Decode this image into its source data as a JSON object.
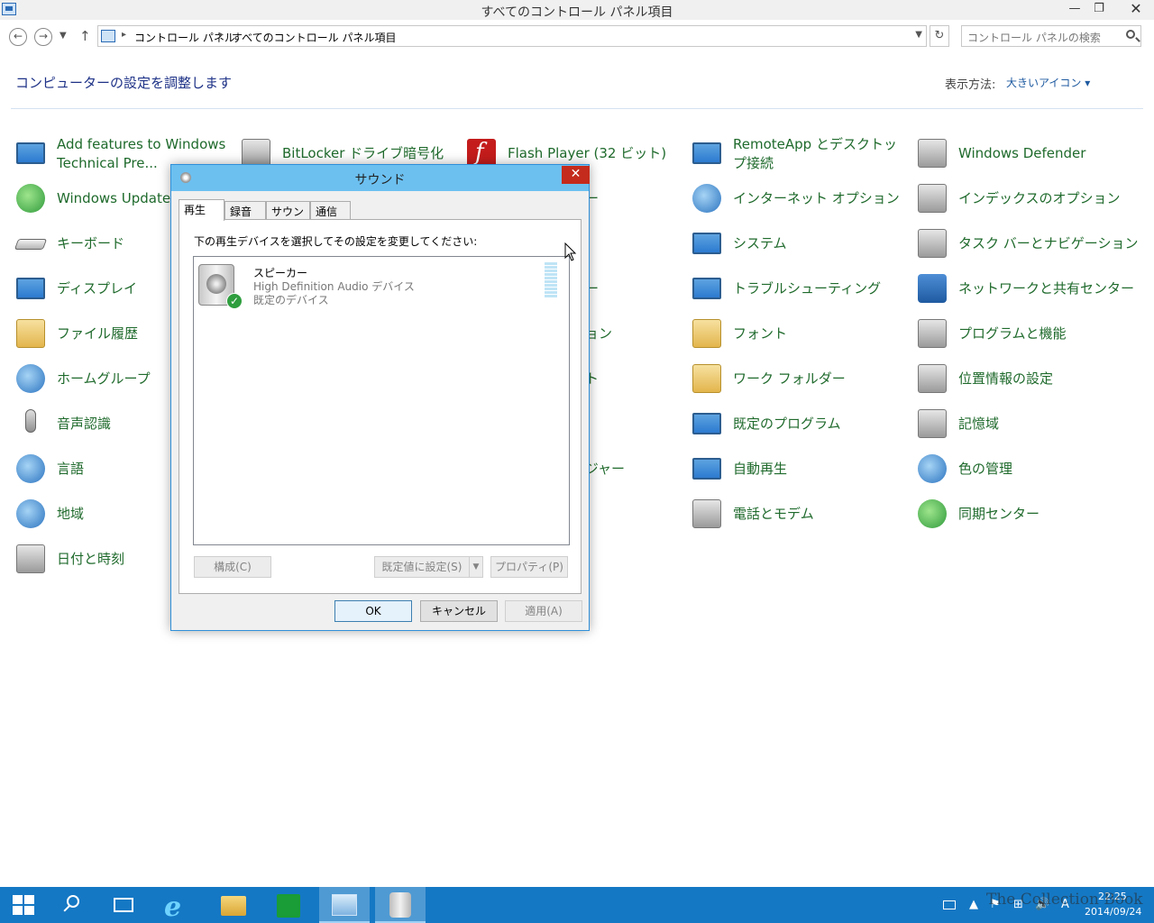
{
  "window": {
    "title": "すべてのコントロール パネル項目",
    "min": "—",
    "max": "❐",
    "close": "✕"
  },
  "address": {
    "crumbs": [
      "コントロール パネル",
      "すべてのコントロール パネル項目"
    ],
    "search_placeholder": "コントロール パネルの検索"
  },
  "header": {
    "title": "コンピューターの設定を調整します",
    "view_by_label": "表示方法:",
    "view_by_value": "大きいアイコン ▾"
  },
  "items": {
    "col1": [
      "Add features to Windows Technical Pre...",
      "Windows Update",
      "キーボード",
      "ディスプレイ",
      "ファイル履歴",
      "ホームグループ",
      "音声認識",
      "言語",
      "地域",
      "日付と時刻"
    ],
    "col2": [
      "BitLocker ドライブ暗号化"
    ],
    "col3": [
      "Flash Player (32 ビット)",
      "ター",
      "ター",
      "ション",
      "ット",
      "ージャー"
    ],
    "col4": [
      "RemoteApp とデスクトップ接続",
      "インターネット オプション",
      "システム",
      "トラブルシューティング",
      "フォント",
      "ワーク フォルダー",
      "既定のプログラム",
      "自動再生",
      "電話とモデム"
    ],
    "col5": [
      "Windows Defender",
      "インデックスのオプション",
      "タスク バーとナビゲーション",
      "ネットワークと共有センター",
      "プログラムと機能",
      "位置情報の設定",
      "記憶域",
      "色の管理",
      "同期センター"
    ]
  },
  "dialog": {
    "title": "サウンド",
    "close": "✕",
    "tabs": [
      "再生",
      "録音",
      "サウンド",
      "通信"
    ],
    "instruction": "下の再生デバイスを選択してその設定を変更してください:",
    "device": {
      "name": "スピーカー",
      "driver": "High Definition Audio デバイス",
      "status": "既定のデバイス",
      "check": "✓"
    },
    "buttons": {
      "configure": "構成(C)",
      "set_default": "既定値に設定(S)",
      "properties": "プロパティ(P)",
      "ok": "OK",
      "cancel": "キャンセル",
      "apply": "適用(A)"
    }
  },
  "taskbar": {
    "time": "22:25",
    "date": "2014/09/24",
    "ime": "A"
  },
  "watermark": "The Collection Book"
}
